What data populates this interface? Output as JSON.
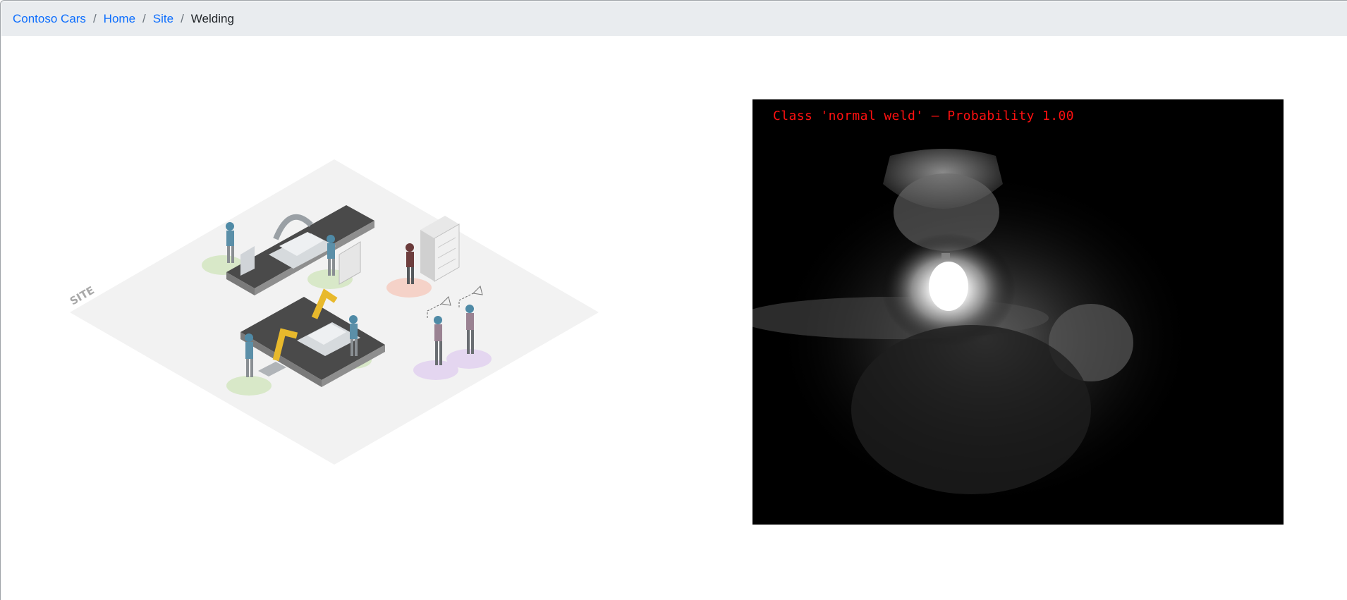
{
  "breadcrumb": {
    "items": [
      {
        "label": "Contoso Cars",
        "link": true
      },
      {
        "label": "Home",
        "link": true
      },
      {
        "label": "Site",
        "link": true
      },
      {
        "label": "Welding",
        "link": false
      }
    ],
    "separator": "/"
  },
  "site_map": {
    "zone_label": "SITE"
  },
  "camera": {
    "prediction_text": "Class 'normal weld' — Probability 1.00"
  },
  "colors": {
    "link": "#0d6efd",
    "breadcrumb_bg": "#e9ecef",
    "prediction": "#ff1010"
  }
}
